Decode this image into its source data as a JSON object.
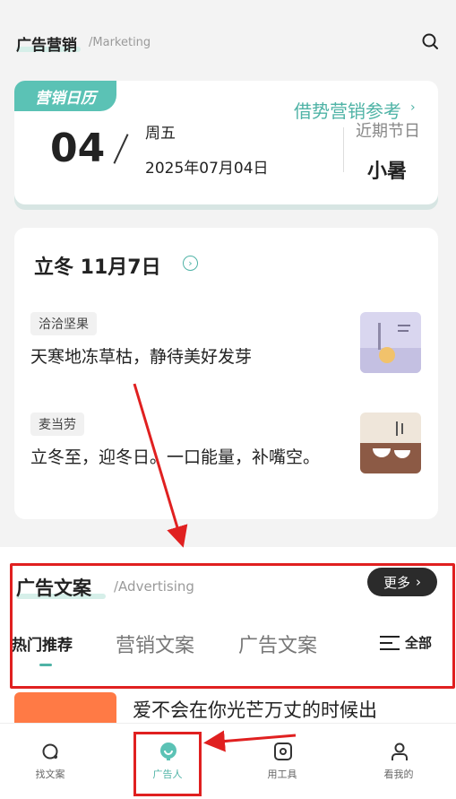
{
  "header": {
    "title": "广告营销",
    "subtitle": "/Marketing"
  },
  "calendar": {
    "tag": "营销日历",
    "day": "04",
    "weekday": "周五",
    "date": "2025年07月04日",
    "ref_link": "借势营销参考",
    "recent_label": "近期节日",
    "holiday": "小暑"
  },
  "solar_term": {
    "title": "立冬 11月7日",
    "items": [
      {
        "brand": "洽洽坚果",
        "text": "天寒地冻草枯，静待美好发芽"
      },
      {
        "brand": "麦当劳",
        "text": "立冬至，迎冬日。一口能量，补嘴空。"
      }
    ]
  },
  "advertising": {
    "title": "广告文案",
    "subtitle": "/Advertising",
    "more_label": "更多",
    "tabs": [
      "热门推荐",
      "营销文案",
      "广告文案"
    ],
    "all_label": "全部",
    "article_title": "爱不会在你光芒万丈的时候出"
  },
  "bottom_nav": {
    "items": [
      {
        "label": "找文案",
        "icon": "search-circle-icon"
      },
      {
        "label": "广告人",
        "icon": "bulb-icon"
      },
      {
        "label": "用工具",
        "icon": "tool-icon"
      },
      {
        "label": "看我的",
        "icon": "user-icon"
      }
    ]
  },
  "colors": {
    "accent": "#5bc2b5",
    "annotation": "#e02020"
  }
}
